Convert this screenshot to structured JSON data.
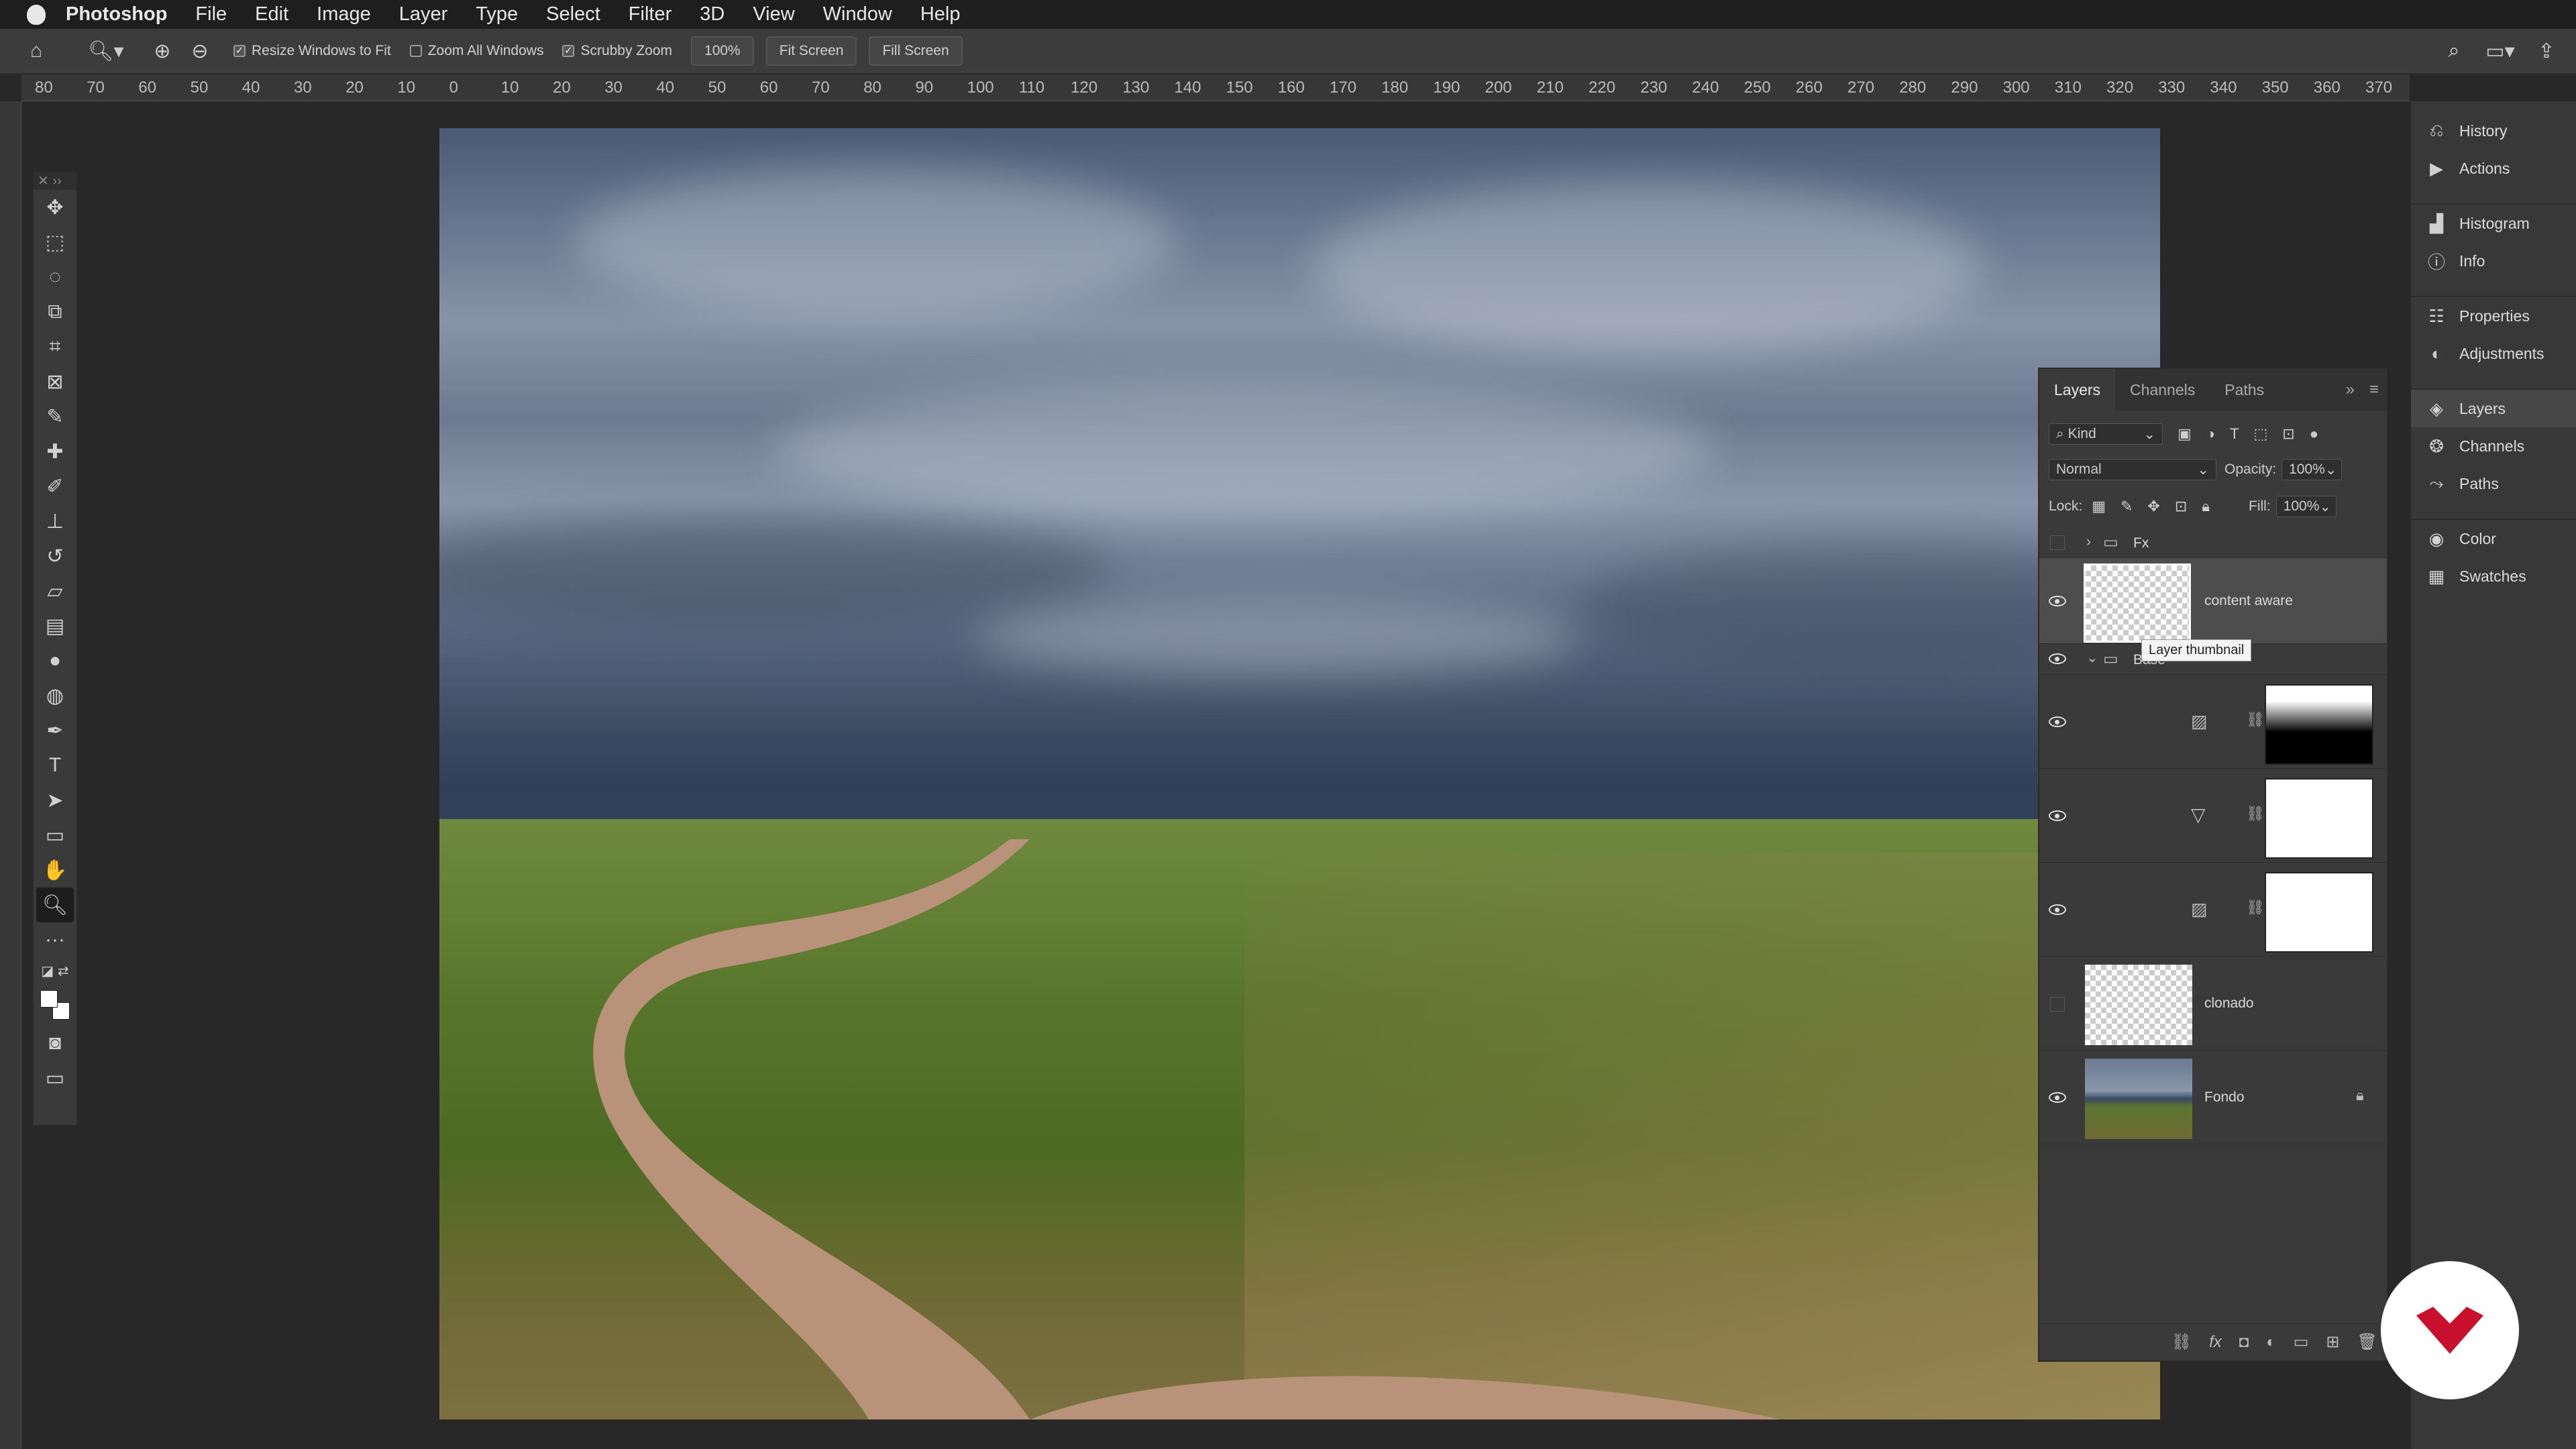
{
  "menubar": {
    "app_name": "Photoshop",
    "items": [
      "File",
      "Edit",
      "Image",
      "Layer",
      "Type",
      "Select",
      "Filter",
      "3D",
      "View",
      "Window",
      "Help"
    ]
  },
  "options_bar": {
    "resize_windows_to_fit": "Resize Windows to Fit",
    "zoom_all_windows": "Zoom All Windows",
    "scrubby_zoom": "Scrubby Zoom",
    "zoom_value": "100%",
    "fit_screen": "Fit Screen",
    "fill_screen": "Fill Screen"
  },
  "ruler": {
    "marks": [
      "80",
      "70",
      "60",
      "50",
      "40",
      "30",
      "20",
      "10",
      "0",
      "10",
      "20",
      "30",
      "40",
      "50",
      "60",
      "70",
      "80",
      "90",
      "100",
      "110",
      "120",
      "130",
      "140",
      "150",
      "160",
      "170",
      "180",
      "190",
      "200",
      "210",
      "220",
      "230",
      "240",
      "250",
      "260",
      "270",
      "280",
      "290",
      "300",
      "310",
      "320",
      "330",
      "340",
      "350",
      "360",
      "370"
    ]
  },
  "dock": {
    "items": [
      {
        "label": "History",
        "icon": "history-icon"
      },
      {
        "label": "Actions",
        "icon": "actions-icon"
      },
      {
        "label": "Histogram",
        "icon": "histogram-icon"
      },
      {
        "label": "Info",
        "icon": "info-icon"
      },
      {
        "label": "Properties",
        "icon": "properties-icon"
      },
      {
        "label": "Adjustments",
        "icon": "adjustments-icon"
      },
      {
        "label": "Layers",
        "icon": "layers-icon"
      },
      {
        "label": "Channels",
        "icon": "channels-icon"
      },
      {
        "label": "Paths",
        "icon": "paths-icon"
      },
      {
        "label": "Color",
        "icon": "color-icon"
      },
      {
        "label": "Swatches",
        "icon": "swatches-icon"
      }
    ]
  },
  "layers_panel": {
    "tabs": [
      "Layers",
      "Channels",
      "Paths"
    ],
    "active_tab": "Layers",
    "filter_kind": "Kind",
    "blend_mode": "Normal",
    "opacity_label": "Opacity:",
    "opacity_value": "100%",
    "lock_label": "Lock:",
    "fill_label": "Fill:",
    "fill_value": "100%",
    "tooltip": "Layer thumbnail",
    "layers": [
      {
        "name": "Fx",
        "type": "group",
        "visible": false
      },
      {
        "name": "content aware",
        "type": "pixel",
        "visible": true,
        "selected": true
      },
      {
        "name": "Base",
        "type": "group",
        "visible": true
      },
      {
        "name": "",
        "type": "adjustment-levels",
        "visible": true
      },
      {
        "name": "",
        "type": "adjustment-vibrance",
        "visible": true
      },
      {
        "name": "",
        "type": "adjustment-levels",
        "visible": true
      },
      {
        "name": "clonado",
        "type": "pixel",
        "visible": false
      },
      {
        "name": "Fondo",
        "type": "background",
        "visible": true,
        "locked": true
      }
    ]
  },
  "colors": {
    "accent_logo": "#c8102e"
  }
}
